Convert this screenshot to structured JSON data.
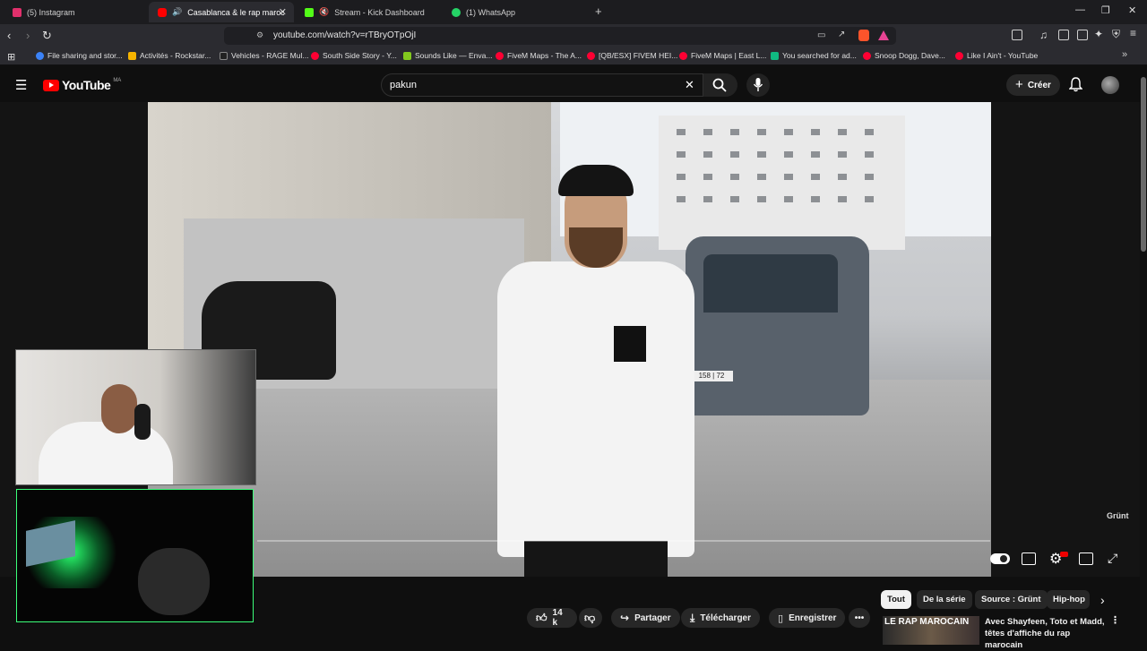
{
  "browser": {
    "tabs": [
      {
        "label": "(5) Instagram",
        "icon_color": "#e1306c",
        "active": false
      },
      {
        "label": "Casablanca & le rap marocain",
        "icon_color": "#ff0000",
        "active": true
      },
      {
        "label": "Stream - Kick Dashboard",
        "icon_color": "#53fc18",
        "active": false
      },
      {
        "label": "(1) WhatsApp",
        "icon_color": "#25d366",
        "active": false
      }
    ],
    "new_tab": "+",
    "url": "youtube.com/watch?v=rTBryOTpOjI",
    "bookmarks": [
      {
        "label": "File sharing and stor...",
        "color": "#3b82f6"
      },
      {
        "label": "Activités - Rockstar...",
        "color": "#f6b400"
      },
      {
        "label": "Vehicles - RAGE Mul...",
        "color": "#222222"
      },
      {
        "label": "South Side Story - Y...",
        "color": "#ff0033"
      },
      {
        "label": "Sounds Like — Enva...",
        "color": "#82c91e"
      },
      {
        "label": "FiveM Maps - The A...",
        "color": "#ff0033"
      },
      {
        "label": "[QB/ESX] FIVEM HEI...",
        "color": "#ff0033"
      },
      {
        "label": "FiveM Maps | East L...",
        "color": "#ff0033"
      },
      {
        "label": "You searched for ad...",
        "color": "#10b981"
      },
      {
        "label": "Snoop Dogg, Dave...",
        "color": "#ff0033"
      },
      {
        "label": "Like I Ain't - YouTube",
        "color": "#ff0033"
      }
    ]
  },
  "youtube": {
    "logo_text": "YouTube",
    "country_code": "MA",
    "search_value": "pakun",
    "create_label": "Créer"
  },
  "video": {
    "watermark": "Grünt",
    "plate": "158 | 72"
  },
  "actions": {
    "likes": "14 k",
    "share": "Partager",
    "download": "Télécharger",
    "save": "Enregistrer"
  },
  "chips": [
    "Tout",
    "De la série",
    "Source : Grünt",
    "Hip-hop"
  ],
  "recommendation": {
    "thumb_text": "LE RAP MAROCAIN",
    "title": "Avec Shayfeen, Toto et Madd, têtes d'affiche du rap marocain"
  }
}
